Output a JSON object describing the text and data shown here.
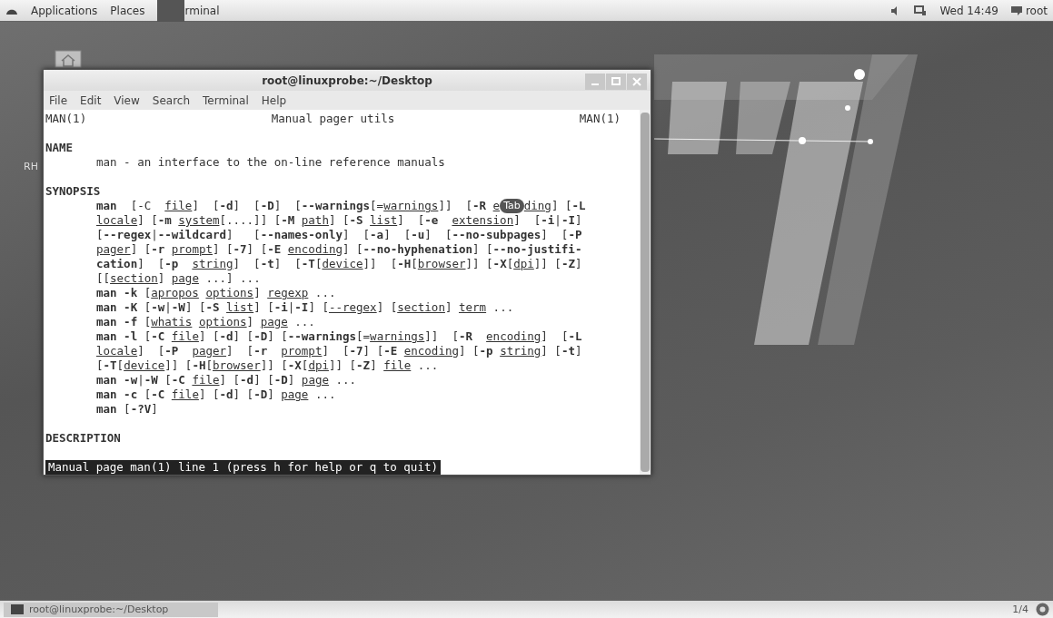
{
  "top_bar": {
    "menus": [
      "Applications",
      "Places"
    ],
    "app": "rminal",
    "clock": "Wed 14:49",
    "user": "root"
  },
  "desktop": {
    "label": "RH"
  },
  "window": {
    "title": "root@linuxprobe:~/Desktop",
    "menu": [
      "File",
      "Edit",
      "View",
      "Search",
      "Terminal",
      "Help"
    ],
    "header": {
      "left": "MAN(1)",
      "center": "Manual pager utils",
      "right": "MAN(1)"
    },
    "sections": [
      {
        "heading": "NAME",
        "lines": [
          [
            {
              "kind": "text",
              "text": "man - an interface to the on-line reference manuals"
            }
          ]
        ]
      },
      {
        "heading": "SYNOPSIS",
        "lines": [
          [
            {
              "kind": "text",
              "text": "**man**  [-C  *file*]  [**-d**]  [**-D**]  [**--warnings**[=*warnings*]]  [**-R** *e*"
            },
            {
              "kind": "tooltip",
              "text": "Tab"
            },
            {
              "kind": "text",
              "text": "*ding*] [**-L**"
            }
          ],
          [
            {
              "kind": "text",
              "text": "*locale*] [**-m** *system*[....]] [**-M** *path*] [**-S** *list*]  [**-e**  *extension*]  [**-i**|**-I**]"
            }
          ],
          [
            {
              "kind": "text",
              "text": "[**--regex**|**--wildcard**]   [**--names-only**]  [**-a**]  [**-u**]  [**--no-subpages**]  [**-P**"
            }
          ],
          [
            {
              "kind": "text",
              "text": "*pager*] [**-r** *prompt*] [**-7**] [**-E** *encoding*] [**--no-hyphenation**] [**--no-justifi-**"
            }
          ],
          [
            {
              "kind": "text",
              "text": "**cation**]  [**-p**  *string*]  [**-t**]  [**-T**[*device*]]  [**-H**[*browser*]] [**-X**[*dpi*]] [**-Z**]"
            }
          ],
          [
            {
              "kind": "text",
              "text": "[[*section*] *page* ...] ..."
            }
          ],
          [
            {
              "kind": "text",
              "text": "**man -k** [*apropos* *options*] *regexp* ..."
            }
          ],
          [
            {
              "kind": "text",
              "text": "**man -K** [**-w**|**-W**] [**-S** *list*] [**-i**|**-I**] [*--regex*] [*section*] *term* ..."
            }
          ],
          [
            {
              "kind": "text",
              "text": "**man -f** [*whatis* *options*] *page* ..."
            }
          ],
          [
            {
              "kind": "text",
              "text": "**man -l** [**-C** *file*] [**-d**] [**-D**] [**--warnings**[=*warnings*]]  [**-R**  *encoding*]  [**-L**"
            }
          ],
          [
            {
              "kind": "text",
              "text": "*locale*]  [**-P**  *pager*]  [**-r**  *prompt*]  [**-7**] [**-E** *encoding*] [**-p** *string*] [**-t**]"
            }
          ],
          [
            {
              "kind": "text",
              "text": "[**-T**[*device*]] [**-H**[*browser*]] [**-X**[*dpi*]] [**-Z**] *file* ..."
            }
          ],
          [
            {
              "kind": "text",
              "text": "**man -w**|**-W** [**-C** *file*] [**-d**] [**-D**] *page* ..."
            }
          ],
          [
            {
              "kind": "text",
              "text": "**man -c** [**-C** *file*] [**-d**] [**-D**] *page* ..."
            }
          ],
          [
            {
              "kind": "text",
              "text": "**man** [**-?V**]"
            }
          ]
        ]
      },
      {
        "heading": "DESCRIPTION"
      }
    ],
    "status": "Manual page man(1) line 1 (press h for help or q to quit)"
  },
  "taskbar": {
    "window": "root@linuxprobe:~/Desktop",
    "workspace": "1/4"
  }
}
